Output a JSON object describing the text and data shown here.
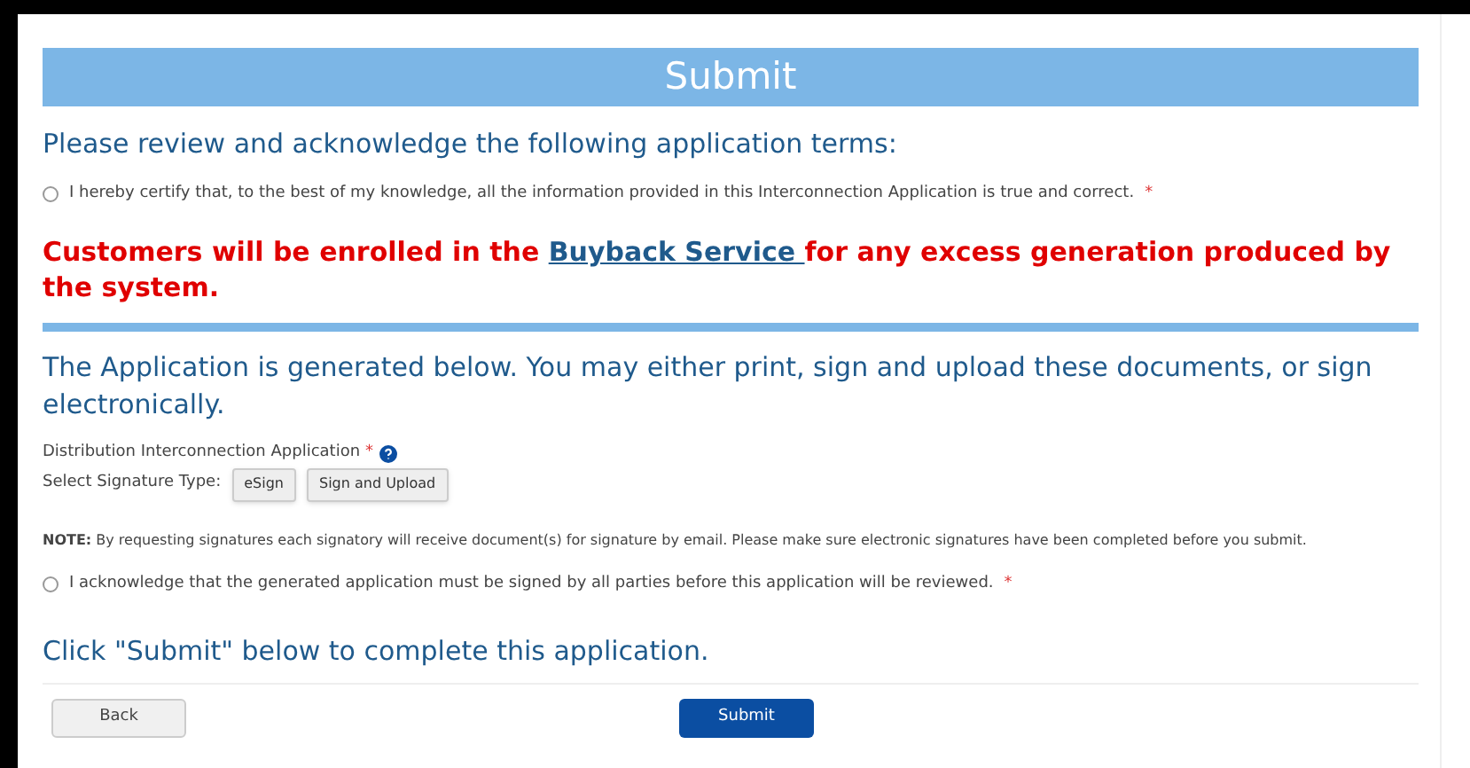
{
  "header": {
    "title": "Submit"
  },
  "terms": {
    "heading": "Please review and acknowledge the following application terms:",
    "certify": {
      "label": "I hereby certify that, to the best of my knowledge, all the information provided in this Interconnection Application is true and correct.",
      "required": "*",
      "checked": false
    }
  },
  "notice": {
    "before": "Customers will be enrolled in the ",
    "link": "Buyback Service ",
    "after": "for any excess generation produced by the system."
  },
  "application": {
    "heading": "The Application is generated below. You may either print, sign and upload these documents, or sign electronically.",
    "document": "Distribution Interconnection Application",
    "required": "*",
    "signature_label": "Select Signature Type:",
    "signature_buttons": [
      "eSign",
      "Sign and Upload"
    ],
    "note": "**NOTE:** By requesting signatures each signatory will receive document(s) for signature by email. Please make sure electronic signatures have been completed before you submit.",
    "acknowledge": {
      "label": "I acknowledge that the generated application must be signed by all parties before this application will be reviewed.",
      "required": "*",
      "checked": false
    }
  },
  "footer": {
    "instruction": "Click \"Submit\" below to complete this application.",
    "back": "Back",
    "submit": "Submit"
  }
}
